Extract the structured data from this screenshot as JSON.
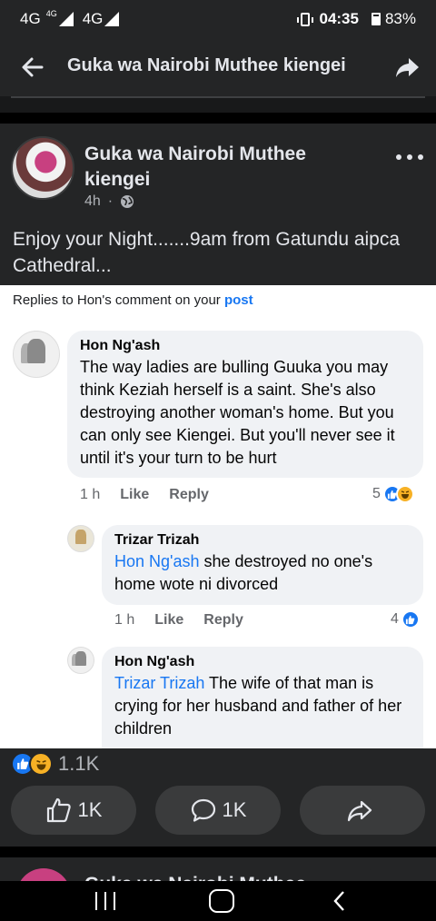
{
  "status_bar": {
    "left_1": "4G",
    "left_sup": "4G",
    "left_2": "4G",
    "time": "04:35",
    "battery": "83%"
  },
  "header": {
    "title": "Guka wa Nairobi Muthee kiengei",
    "back_icon": "arrow-left-icon",
    "share_icon": "share-icon"
  },
  "post": {
    "author": "Guka wa Nairobi Muthee kiengei",
    "time": "4h",
    "dot": "·",
    "privacy_icon": "globe-icon",
    "text": "Enjoy your Night.......9am from Gatundu aipca Cathedral...",
    "shared": {
      "replies_prefix": "Replies to Hon's comment on your ",
      "replies_link": "post",
      "comments": [
        {
          "name": "Hon Ng'ash",
          "text": "The way ladies are bulling Guuka you may think Keziah herself is a saint. She's also destroying another woman's home. But you can only see Kiengei. But you'll never see it until it's your turn to be hurt",
          "time": "1 h",
          "like": "Like",
          "reply": "Reply",
          "reaction_count": "5"
        },
        {
          "name": "Trizar Trizah",
          "tag": "Hon Ng'ash",
          "text": " she destroyed no one's home wote ni divorced",
          "time": "1 h",
          "like": "Like",
          "reply": "Reply",
          "reaction_count": "4"
        },
        {
          "name": "Hon Ng'ash",
          "tag": "Trizar Trizah",
          "text": " The wife of that man is crying for her husband and father of her children"
        }
      ]
    },
    "reactions_count": "1.1K",
    "like_count": "1K",
    "comment_count": "1K"
  },
  "next_post": {
    "author": "Guka wa Nairobi Muthee"
  },
  "colors": {
    "accent": "#1877f2",
    "bg_dark": "#242526",
    "haha": "#f7b125"
  }
}
